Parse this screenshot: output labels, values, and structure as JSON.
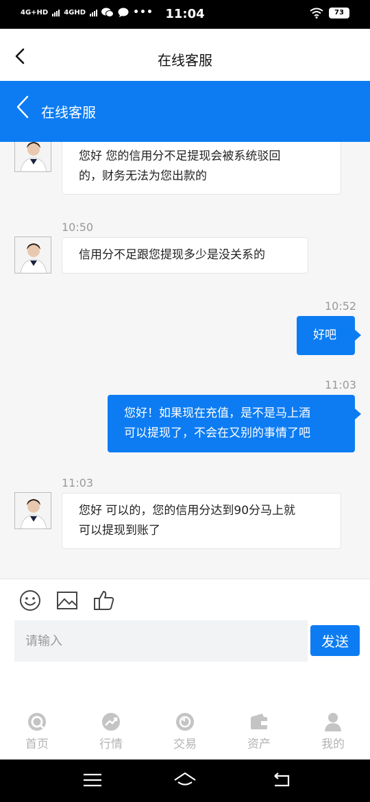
{
  "status": {
    "network_1": "4G+HD",
    "network_2": "4GHD",
    "time": "11:04",
    "battery": "73"
  },
  "topnav": {
    "title": "在线客服"
  },
  "header": {
    "title": "在线客服"
  },
  "messages": [
    {
      "side": "left",
      "text_line1": "您好 您的信用分不足提现会被系统驳回",
      "text_line2": "的，财务无法为您出款的"
    },
    {
      "side": "left",
      "time": "10:50",
      "text": "信用分不足跟您提现多少是没关系的"
    },
    {
      "side": "right",
      "time": "10:52",
      "text": "好吧"
    },
    {
      "side": "right",
      "time": "11:03",
      "text_line1": "您好！如果现在充值，是不是马上酒",
      "text_line2": "可以提现了，不会在又别的事情了吧"
    },
    {
      "side": "left",
      "time": "11:03",
      "text_line1": "您好 可以的，您的信用分达到90分马上就",
      "text_line2": "可以提现到账了"
    }
  ],
  "composer": {
    "placeholder": "请输入",
    "send_label": "发送",
    "icons": [
      "emoji-icon",
      "image-icon",
      "thumbs-up-icon"
    ]
  },
  "tabs": [
    {
      "label": "首页",
      "icon": "home-icon"
    },
    {
      "label": "行情",
      "icon": "trend-icon"
    },
    {
      "label": "交易",
      "icon": "exchange-icon"
    },
    {
      "label": "资产",
      "icon": "wallet-icon"
    },
    {
      "label": "我的",
      "icon": "user-icon"
    }
  ],
  "colors": {
    "accent": "#0d7cf2",
    "tab_inactive": "#b3b3b3"
  }
}
